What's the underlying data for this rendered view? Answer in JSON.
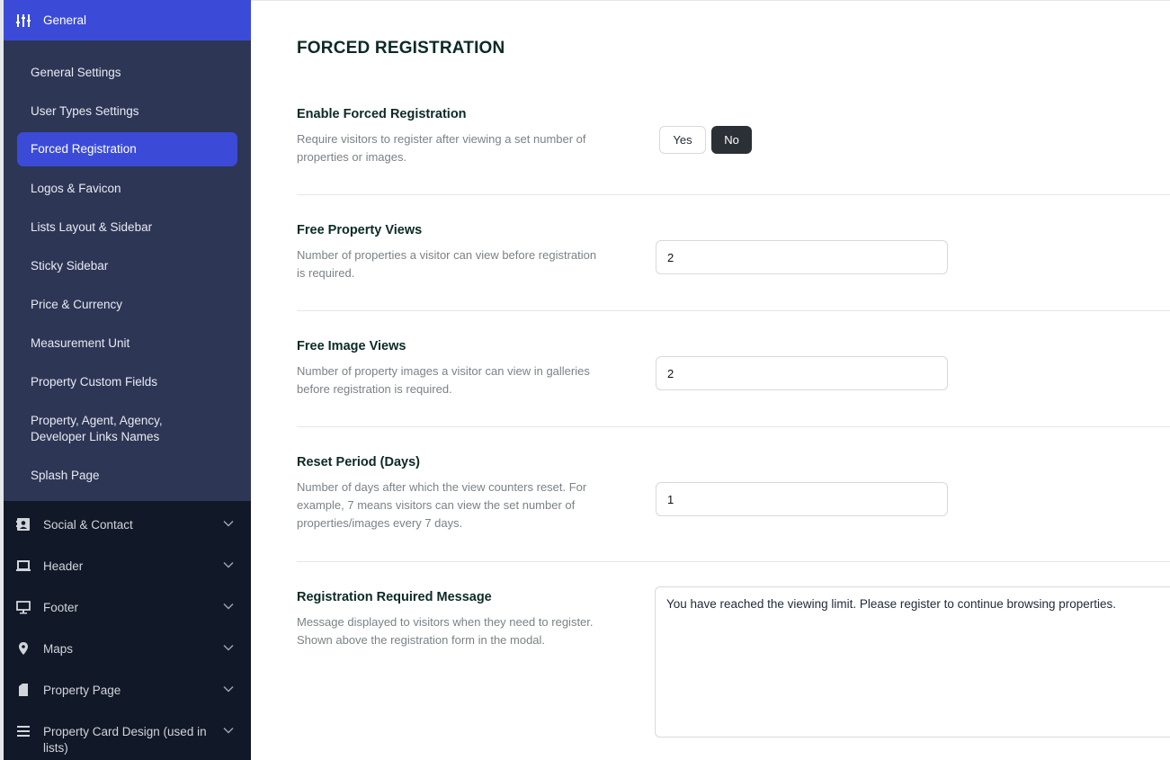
{
  "sidebar": {
    "top": {
      "label": "General",
      "icon": "sliders-icon"
    },
    "submenu": [
      {
        "label": "General Settings"
      },
      {
        "label": "User Types Settings"
      },
      {
        "label": "Forced Registration",
        "active": true
      },
      {
        "label": "Logos & Favicon"
      },
      {
        "label": "Lists Layout & Sidebar"
      },
      {
        "label": "Sticky Sidebar"
      },
      {
        "label": "Price & Currency"
      },
      {
        "label": "Measurement Unit"
      },
      {
        "label": "Property Custom Fields"
      },
      {
        "label": "Property, Agent, Agency,",
        "label2": "Developer Links Names"
      },
      {
        "label": "Splash Page"
      }
    ],
    "categories": [
      {
        "label": "Social & Contact",
        "icon": "contact-card-icon"
      },
      {
        "label": "Header",
        "icon": "laptop-icon"
      },
      {
        "label": "Footer",
        "icon": "monitor-icon"
      },
      {
        "label": "Maps",
        "icon": "map-pin-icon"
      },
      {
        "label": "Property Page",
        "icon": "document-icon"
      },
      {
        "label": "Property Card Design (used in",
        "label2": "lists)",
        "icon": "list-icon"
      }
    ]
  },
  "main": {
    "title": "FORCED REGISTRATION",
    "sections": {
      "enable": {
        "label": "Enable Forced Registration",
        "desc1": "Require visitors to register after viewing a set number of",
        "desc2": "properties or images.",
        "yes_label": "Yes",
        "no_label": "No",
        "selected": "No"
      },
      "property_views": {
        "label": "Free Property Views",
        "desc1": "Number of properties a visitor can view before registration",
        "desc2": "is required.",
        "value": "2"
      },
      "image_views": {
        "label": "Free Image Views",
        "desc1": "Number of property images a visitor can view in galleries",
        "desc2": "before registration is required.",
        "value": "2"
      },
      "reset_period": {
        "label": "Reset Period (Days)",
        "desc1": "Number of days after which the view counters reset. For",
        "desc2": "example, 7 means visitors can view the set number of",
        "desc3": "properties/images every 7 days.",
        "value": "1"
      },
      "message": {
        "label": "Registration Required Message",
        "desc1": "Message displayed to visitors when they need to register.",
        "desc2": "Shown above the registration form in the modal.",
        "value": "You have reached the viewing limit. Please register to continue browsing properties."
      }
    }
  },
  "colors": {
    "accent": "#3b4bd8",
    "sidebar_dark": "#111827",
    "submenu_bg": "#2d3655",
    "heading": "#0b2a25"
  }
}
